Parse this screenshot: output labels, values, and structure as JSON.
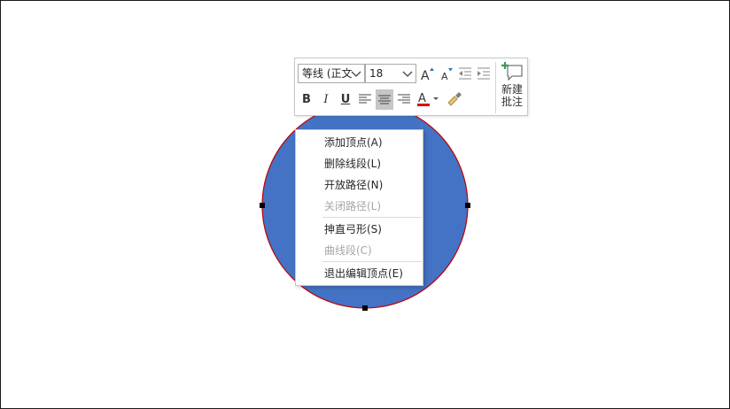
{
  "toolbar": {
    "font_name": "等线 (正文",
    "font_size": "18",
    "new_comment_line1": "新建",
    "new_comment_line2": "批注",
    "bold_label": "B",
    "italic_label": "I",
    "underline_label": "U"
  },
  "context_menu": {
    "items": [
      {
        "label": "添加顶点(A)",
        "enabled": true
      },
      {
        "label": "删除线段(L)",
        "enabled": true
      },
      {
        "label": "开放路径(N)",
        "enabled": true
      },
      {
        "label": "关闭路径(L)",
        "enabled": false
      },
      {
        "label": "抻直弓形(S)",
        "enabled": true
      },
      {
        "label": "曲线段(C)",
        "enabled": false
      },
      {
        "label": "退出编辑顶点(E)",
        "enabled": true
      }
    ]
  },
  "colors": {
    "shape_fill": "#4472c4",
    "shape_outline": "#c00000",
    "font_color_bar": "#e00000",
    "highlight_active": "#c6c6c6"
  },
  "icons": [
    "increase-font-icon",
    "decrease-font-icon",
    "decrease-indent-icon",
    "increase-indent-icon",
    "align-left-icon",
    "align-center-icon",
    "align-right-icon",
    "font-color-icon",
    "format-painter-icon",
    "new-comment-icon",
    "chevron-down-icon"
  ]
}
